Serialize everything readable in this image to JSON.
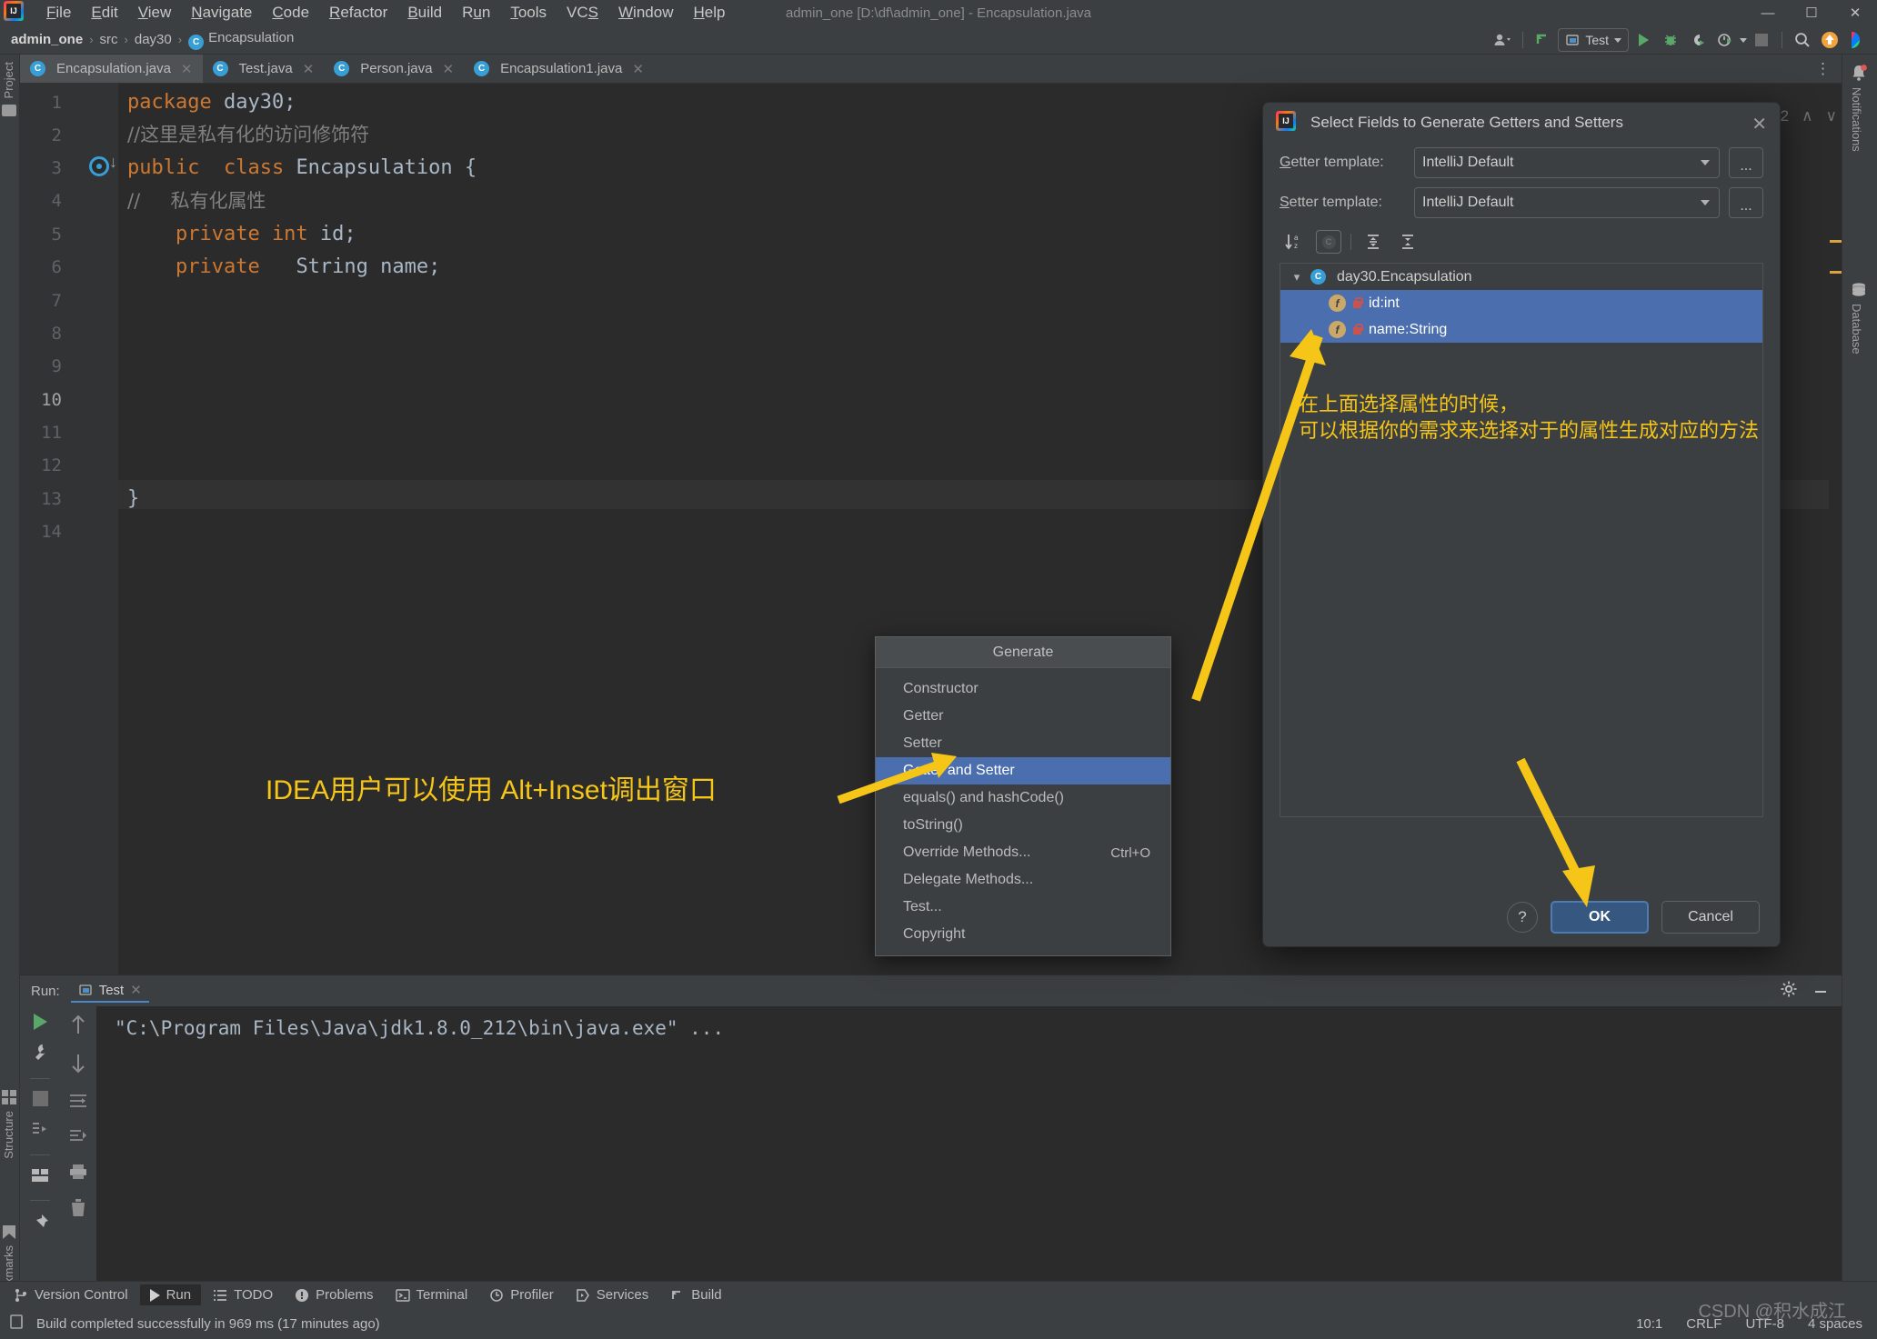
{
  "window": {
    "title": "admin_one [D:\\df\\admin_one] - Encapsulation.java",
    "minimize": "—",
    "maximize": "☐",
    "close": "✕"
  },
  "menubar": {
    "items": [
      "File",
      "Edit",
      "View",
      "Navigate",
      "Code",
      "Refactor",
      "Build",
      "Run",
      "Tools",
      "VCS",
      "Window",
      "Help"
    ]
  },
  "navbar": {
    "crumbs": [
      "admin_one",
      "src",
      "day30",
      "Encapsulation"
    ],
    "separator": "›",
    "class_badge": "C"
  },
  "toolbar": {
    "run_config": "Test",
    "icons": [
      "user-icon",
      "vcs-update-icon",
      "run-icon",
      "debug-icon",
      "run-coverage-icon",
      "profiler-icon",
      "stop-icon",
      "search-icon",
      "update-icon",
      "ai-assistant-icon"
    ]
  },
  "stripes": {
    "left_top": "Project",
    "left_bottom": [
      "Structure",
      "Bookmarks"
    ],
    "right": [
      "Notifications",
      "Database"
    ]
  },
  "tabs": [
    {
      "label": "Encapsulation.java",
      "icon": "java-class-icon",
      "active": true,
      "close": "✕"
    },
    {
      "label": "Test.java",
      "icon": "java-runnable-class-icon",
      "active": false,
      "close": "✕"
    },
    {
      "label": "Person.java",
      "icon": "java-class-icon",
      "active": false,
      "close": "✕"
    },
    {
      "label": "Encapsulation1.java",
      "icon": "java-class-icon",
      "active": false,
      "close": "✕"
    }
  ],
  "editor": {
    "line_numbers": [
      "1",
      "2",
      "3",
      "4",
      "5",
      "6",
      "7",
      "8",
      "9",
      "10",
      "11",
      "12",
      "13",
      "14"
    ],
    "current_line": "10",
    "lines": [
      {
        "n": 1,
        "segments": [
          {
            "t": "package ",
            "c": "kw"
          },
          {
            "t": "day30;",
            "c": "pl"
          }
        ]
      },
      {
        "n": 2,
        "segments": [
          {
            "t": "//这里是私有化的访问修饰符",
            "c": "cm"
          }
        ]
      },
      {
        "n": 3,
        "segments": [
          {
            "t": "public  class ",
            "c": "kw"
          },
          {
            "t": "Encapsulation {",
            "c": "pl"
          }
        ]
      },
      {
        "n": 4,
        "segments": [
          {
            "t": "//     私有化属性",
            "c": "cm"
          }
        ]
      },
      {
        "n": 5,
        "segments": [
          {
            "t": "    private int ",
            "c": "kw"
          },
          {
            "t": "id;",
            "c": "pl"
          }
        ]
      },
      {
        "n": 6,
        "segments": [
          {
            "t": "    private   ",
            "c": "kw"
          },
          {
            "t": "String ",
            "c": "pl"
          },
          {
            "t": "name;",
            "c": "pl"
          }
        ]
      },
      {
        "n": 13,
        "segments": [
          {
            "t": "}",
            "c": "pl"
          }
        ]
      }
    ]
  },
  "generate_popup": {
    "title": "Generate",
    "items": [
      {
        "label": "Constructor",
        "shortcut": "",
        "selected": false
      },
      {
        "label": "Getter",
        "shortcut": "",
        "selected": false
      },
      {
        "label": "Setter",
        "shortcut": "",
        "selected": false
      },
      {
        "label": "Getter and Setter",
        "shortcut": "",
        "selected": true
      },
      {
        "label": "equals() and hashCode()",
        "shortcut": "",
        "selected": false
      },
      {
        "label": "toString()",
        "shortcut": "",
        "selected": false
      },
      {
        "label": "Override Methods...",
        "shortcut": "Ctrl+O",
        "selected": false
      },
      {
        "label": "Delegate Methods...",
        "shortcut": "",
        "selected": false
      },
      {
        "label": "Test...",
        "shortcut": "",
        "selected": false
      },
      {
        "label": "Copyright",
        "shortcut": "",
        "selected": false
      }
    ]
  },
  "dialog": {
    "title": "Select Fields to Generate Getters and Setters",
    "close": "✕",
    "getter_label": "Getter template:",
    "getter_value": "IntelliJ Default",
    "setter_label": "Setter template:",
    "setter_value": "IntelliJ Default",
    "ellipsis": "...",
    "toolbar_icons": [
      "sort-alphabetically-icon",
      "show-class-icon",
      "expand-all-icon",
      "collapse-all-icon"
    ],
    "tree": {
      "root": {
        "label": "day30.Encapsulation",
        "icon": "java-class-icon",
        "expanded": true
      },
      "fields": [
        {
          "label": "id:int",
          "icon": "field-icon",
          "visibility": "private-lock-icon",
          "selected": true
        },
        {
          "label": "name:String",
          "icon": "field-icon",
          "visibility": "private-lock-icon",
          "selected": true
        }
      ]
    },
    "help": "?",
    "ok": "OK",
    "cancel": "Cancel"
  },
  "annotations": {
    "generate_hint": "IDEA用户可以使用 Alt+Inset调出窗口",
    "dialog_hint_line1": "在上面选择属性的时候，",
    "dialog_hint_line2": "可以根据你的需求来选择对于的属性生成对应的方法",
    "color": "#f5c518"
  },
  "run_panel": {
    "label": "Run:",
    "tab": "Test",
    "tab_close": "✕",
    "console_line": "\"C:\\Program Files\\Java\\jdk1.8.0_212\\bin\\java.exe\" ...",
    "left_tools": [
      "rerun-icon",
      "settings-wrench-icon",
      "stop-icon",
      "rerun-failed-icon",
      "layout-icon",
      "pin-icon"
    ],
    "left_tools2": [
      "up-arrow-icon",
      "down-arrow-icon",
      "soft-wrap-icon",
      "scroll-to-end-icon",
      "print-icon",
      "clear-all-icon"
    ],
    "head_right": [
      "gear-icon",
      "minimize-icon"
    ]
  },
  "toolwindow_bar": {
    "items": [
      {
        "label": "Version Control",
        "icon": "branch-icon",
        "active": false
      },
      {
        "label": "Run",
        "icon": "run-icon",
        "active": true
      },
      {
        "label": "TODO",
        "icon": "list-icon",
        "active": false
      },
      {
        "label": "Problems",
        "icon": "problems-icon",
        "active": false
      },
      {
        "label": "Terminal",
        "icon": "terminal-icon",
        "active": false
      },
      {
        "label": "Profiler",
        "icon": "profiler-icon",
        "active": false
      },
      {
        "label": "Services",
        "icon": "services-icon",
        "active": false
      },
      {
        "label": "Build",
        "icon": "build-icon",
        "active": false
      }
    ]
  },
  "statusbar": {
    "message": "Build completed successfully in 969 ms (17 minutes ago)",
    "icon": "build-status-icon",
    "caret": "10:1",
    "line_separator": "CRLF",
    "encoding": "UTF-8",
    "indent": "4 spaces"
  },
  "watermark": "CSDN @积水成江",
  "editor_scroll": {
    "position": "2",
    "up": "∧",
    "down": "∨"
  },
  "colors": {
    "accent_blue": "#4b6eaf",
    "selection_blue": "#365880",
    "annotation_yellow": "#f5c518",
    "keyword_orange": "#cc7832",
    "editor_bg": "#2b2b2b",
    "panel_bg": "#3c3f41"
  }
}
